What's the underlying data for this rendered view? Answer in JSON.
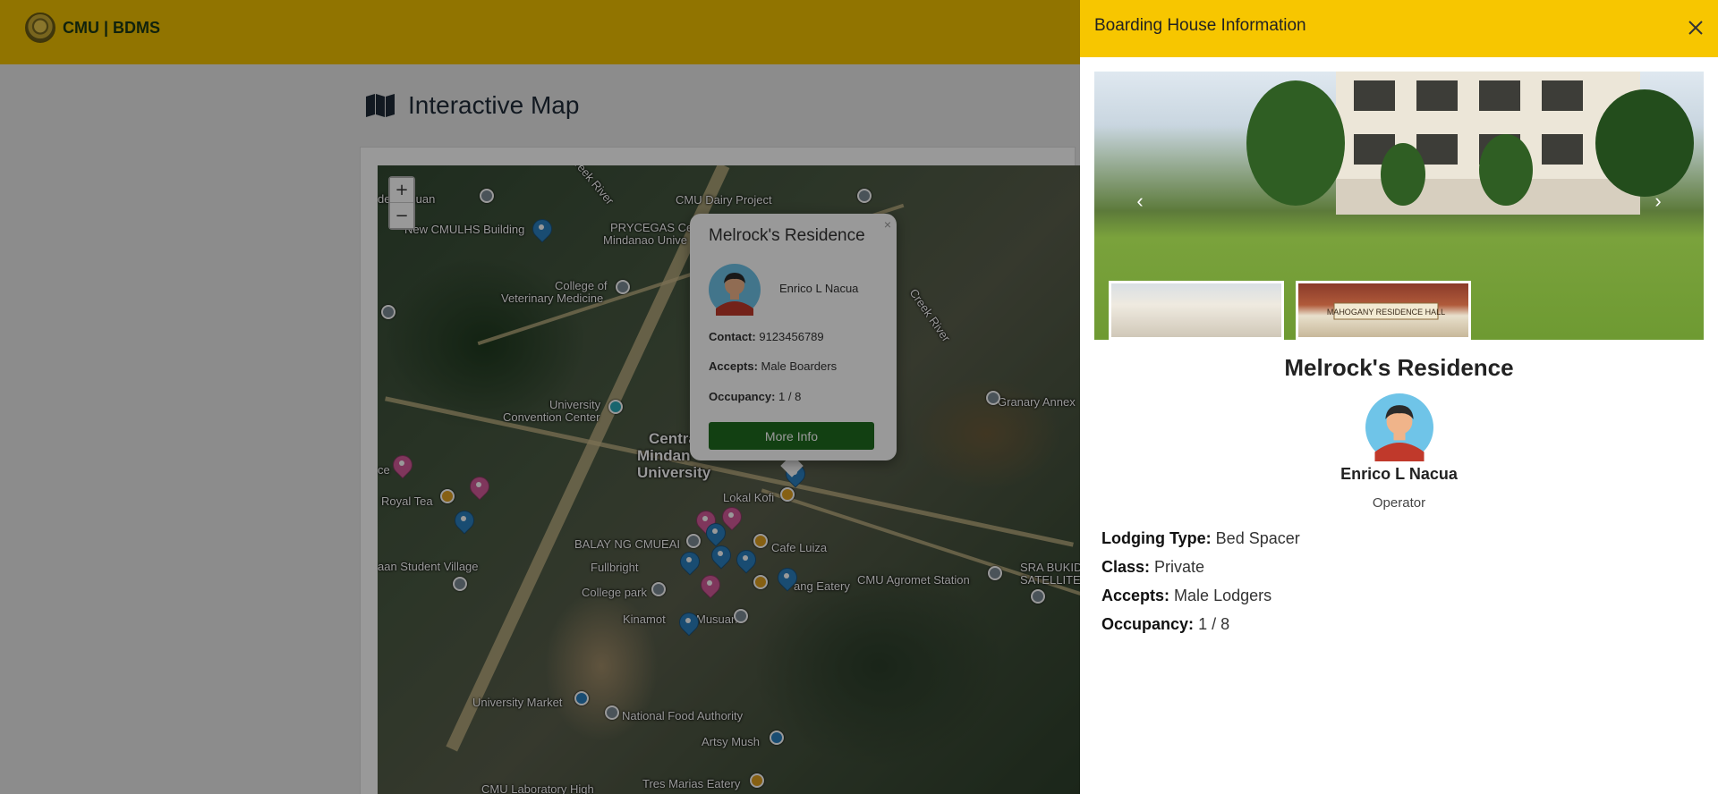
{
  "navbar": {
    "brand": "CMU | BDMS"
  },
  "page": {
    "title": "Interactive Map"
  },
  "map": {
    "zoom_in": "+",
    "zoom_out": "−",
    "labels": {
      "musuan": "de Musuan",
      "new_cmulhs": "New CMULHS Building",
      "dairy": "CMU Dairy Project",
      "prycegas": "PRYCEGAS Ce",
      "mindanao_univ": "Mindanao Unive",
      "vet_med_1": "College of",
      "vet_med_2": "Veterinary Medicine",
      "creek_river_1": "Creek River",
      "creek_river_2": "Creek River",
      "conv_center_1": "University",
      "conv_center_2": "Convention Center",
      "central_1": "Centra",
      "central_2": "Mindan",
      "central_3": "University",
      "royal_tea": "Royal Tea",
      "lokal_kofi": "Lokal Kofi",
      "balay": "BALAY NG CMUEAI",
      "cafe_luiza": "Cafe Luiza",
      "fullbright": "Fullbright",
      "student_village": "aan Student Village",
      "college_park": "College park",
      "eatery": "ang Eatery",
      "agromet": "CMU Agromet Station",
      "sra_1": "SRA BUKID",
      "sra_2": "SATELLITE",
      "kinamot": "Kinamot",
      "musuan2": "Musuan",
      "granary": "Granary Annex",
      "univ_market": "University Market",
      "nfa": "National Food Authority",
      "artsy": "Artsy Mush",
      "cmu_lab": "CMU Laboratory High",
      "tres_marias": "Tres Marias Eatery",
      "ce": "ce"
    }
  },
  "popup": {
    "title": "Melrock's Residence",
    "close": "×",
    "operator": "Enrico L Nacua",
    "contact_label": "Contact:",
    "contact": "9123456789",
    "accepts_label": "Accepts:",
    "accepts": "Male Boarders",
    "occupancy_label": "Occupancy:",
    "occupancy": "1 / 8",
    "button": "More Info"
  },
  "panel": {
    "title": "Boarding House Information",
    "name": "Melrock's Residence",
    "operator": "Enrico L Nacua",
    "role": "Operator",
    "details": [
      {
        "label": "Lodging Type:",
        "value": "Bed Spacer"
      },
      {
        "label": "Class:",
        "value": "Private"
      },
      {
        "label": "Accepts:",
        "value": "Male Lodgers"
      },
      {
        "label": "Occupancy:",
        "value": "1 / 8"
      }
    ],
    "thumb2_sign": "MAHOGANY RESIDENCE HALL"
  },
  "colors": {
    "brand_yellow": "#f2c200",
    "panel_yellow": "#f7c600",
    "button_green": "#1f6b1f",
    "pin_blue": "#2a7fbf",
    "pin_pink": "#d45a9a",
    "pin_orange": "#e0a020",
    "pin_grey": "#7c8a94"
  }
}
